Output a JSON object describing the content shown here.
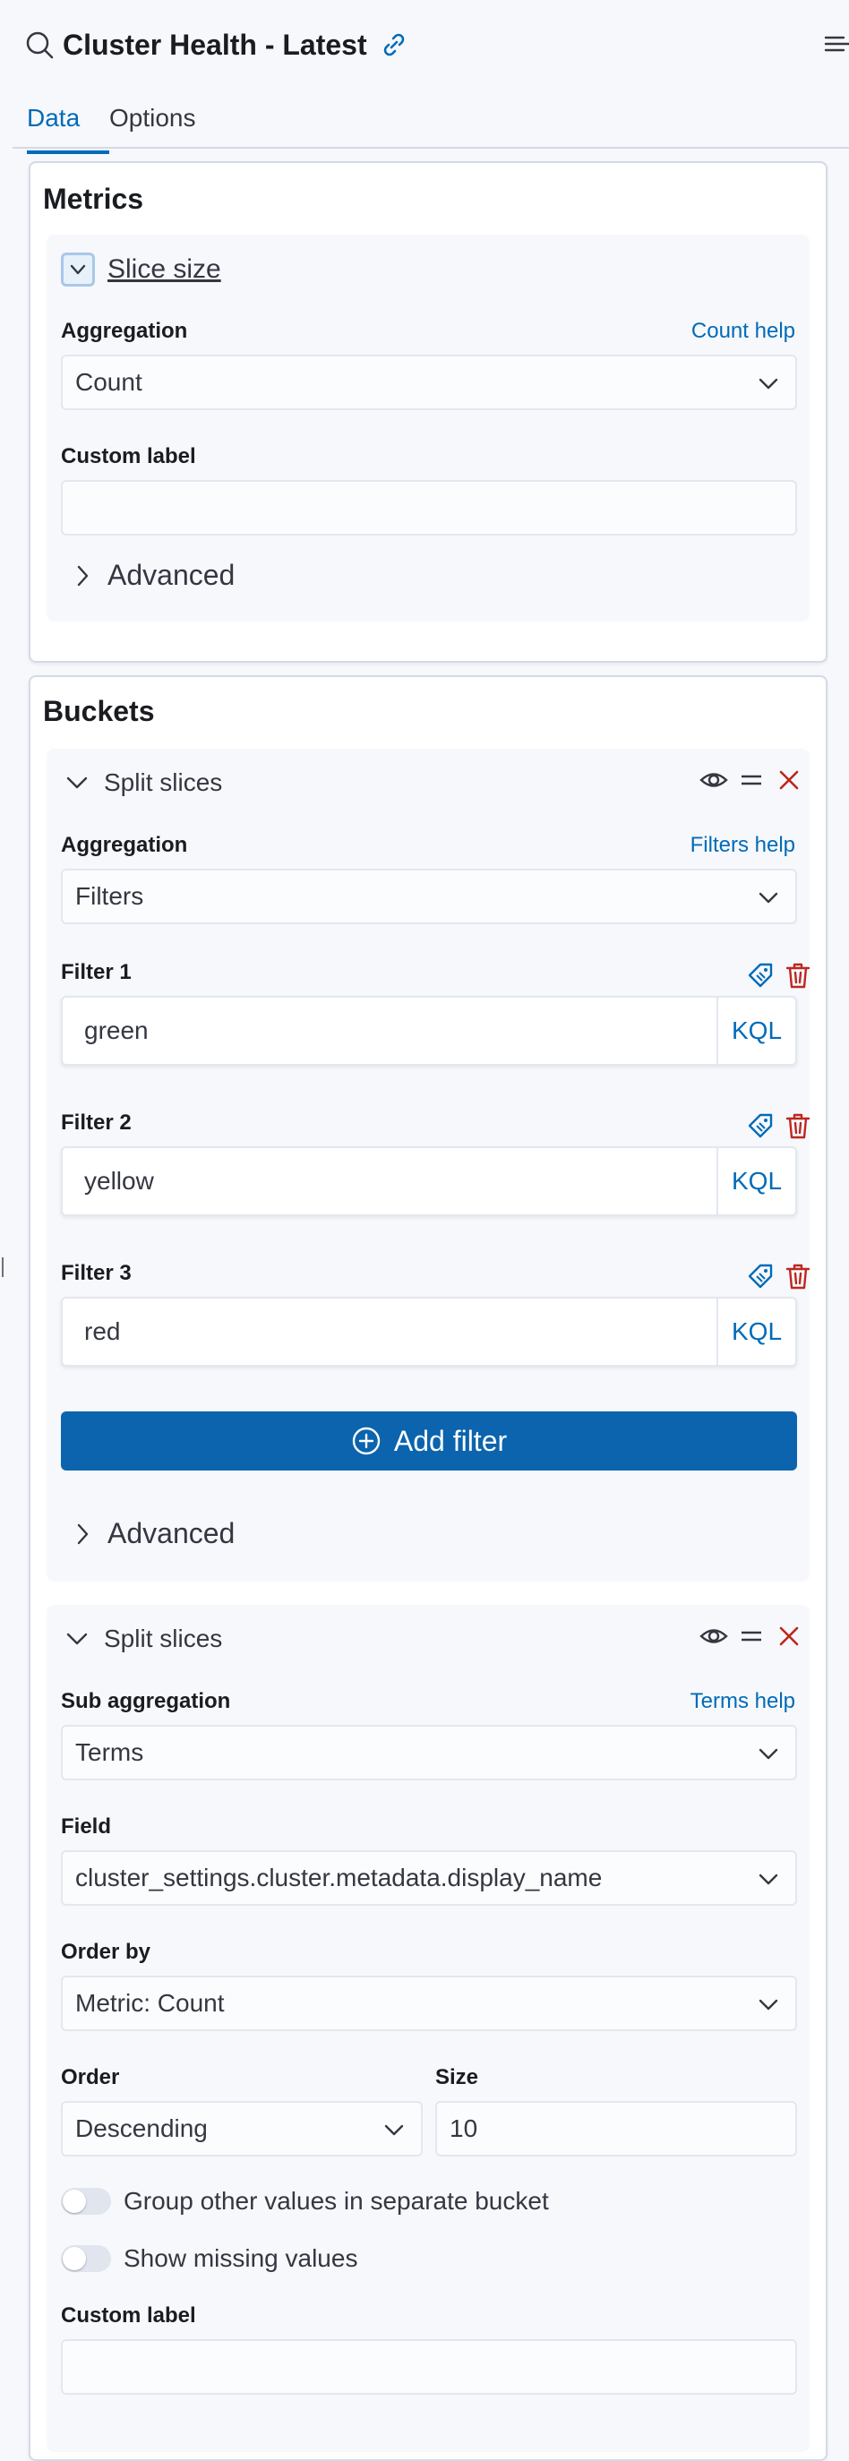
{
  "header": {
    "title": "Cluster Health - Latest",
    "icons": {
      "search": "search-icon",
      "link": "link-icon",
      "menu": "sidebar-collapse-icon"
    }
  },
  "tabs": [
    {
      "label": "Data",
      "active": true
    },
    {
      "label": "Options",
      "active": false
    }
  ],
  "metrics": {
    "title": "Metrics",
    "agg": {
      "name": "Slice size",
      "aggregation_label": "Aggregation",
      "help": "Count help",
      "aggregation_value": "Count",
      "custom_label": "Custom label",
      "custom_label_value": "",
      "advanced": "Advanced"
    }
  },
  "buckets": {
    "title": "Buckets",
    "split1": {
      "name": "Split slices",
      "aggregation_label": "Aggregation",
      "help": "Filters help",
      "aggregation_value": "Filters",
      "filters": [
        {
          "label": "Filter 1",
          "value": "green",
          "lang": "KQL"
        },
        {
          "label": "Filter 2",
          "value": "yellow",
          "lang": "KQL"
        },
        {
          "label": "Filter 3",
          "value": "red",
          "lang": "KQL"
        }
      ],
      "add_filter": "Add filter",
      "advanced": "Advanced"
    },
    "split2": {
      "name": "Split slices",
      "sub_agg_label": "Sub aggregation",
      "help": "Terms help",
      "sub_agg_value": "Terms",
      "field_label": "Field",
      "field_value": "cluster_settings.cluster.metadata.display_name",
      "order_by_label": "Order by",
      "order_by_value": "Metric: Count",
      "order_label": "Order",
      "order_value": "Descending",
      "size_label": "Size",
      "size_value": "10",
      "group_other": "Group other values in separate bucket",
      "group_other_on": false,
      "show_missing": "Show missing values",
      "show_missing_on": false,
      "custom_label": "Custom label",
      "custom_label_value": ""
    }
  },
  "colors": {
    "accent": "#006bb8",
    "button": "#0b64ad",
    "danger": "#bd271e",
    "text": "#1a1c21"
  }
}
